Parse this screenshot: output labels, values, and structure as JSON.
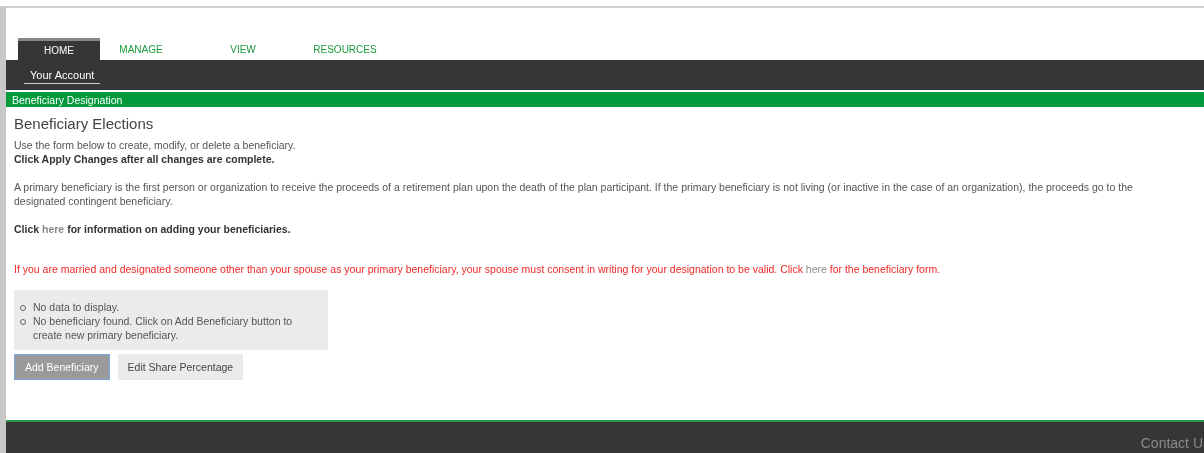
{
  "tabs": [
    {
      "label": "HOME",
      "selected": true
    },
    {
      "label": "MANAGE",
      "selected": false
    },
    {
      "label": "VIEW",
      "selected": false
    },
    {
      "label": "RESOURCES",
      "selected": false
    }
  ],
  "subnav": [
    {
      "label": "Your Account",
      "selected": true
    }
  ],
  "section_bar": {
    "title": "Beneficiary Designation"
  },
  "heading": "Beneficiary Elections",
  "paragraphs": [
    {
      "kind": "normal",
      "segments": [
        {
          "kind": "text",
          "text": "Use the form below to create, modify, or delete a beneficiary."
        }
      ]
    },
    {
      "kind": "bold",
      "segments": [
        {
          "kind": "text",
          "text": "Click Apply Changes after all changes are complete."
        }
      ]
    },
    {
      "kind": "spaced",
      "segments": [
        {
          "kind": "text",
          "text": "A primary beneficiary is the first person or organization to receive the proceeds of a retirement plan upon the death of the plan participant. If the primary beneficiary is not living (or inactive in the case of an organization), the proceeds go to the designated contingent beneficiary."
        }
      ]
    },
    {
      "kind": "bold-spaced",
      "segments": [
        {
          "kind": "text",
          "text": "Click"
        },
        {
          "kind": "link",
          "text": "here"
        },
        {
          "kind": "text",
          "text": "for information on adding your beneficiaries."
        }
      ]
    },
    {
      "kind": "warning",
      "segments": [
        {
          "kind": "text",
          "text": "If you are married and designated someone other than your spouse as your primary beneficiary, your spouse must consent in writing for your designation to be valid. Click"
        },
        {
          "kind": "link",
          "text": "here"
        },
        {
          "kind": "text",
          "text": "for the beneficiary form."
        }
      ]
    }
  ],
  "messages": [
    "No data to display.",
    "No beneficiary found. Click on Add Beneficiary button to create new primary beneficiary."
  ],
  "buttons": [
    {
      "label": "Add Beneficiary",
      "kind": "primary"
    },
    {
      "label": "Edit Share Percentage",
      "kind": "secondary"
    }
  ],
  "footer": {
    "link": "Contact U"
  }
}
